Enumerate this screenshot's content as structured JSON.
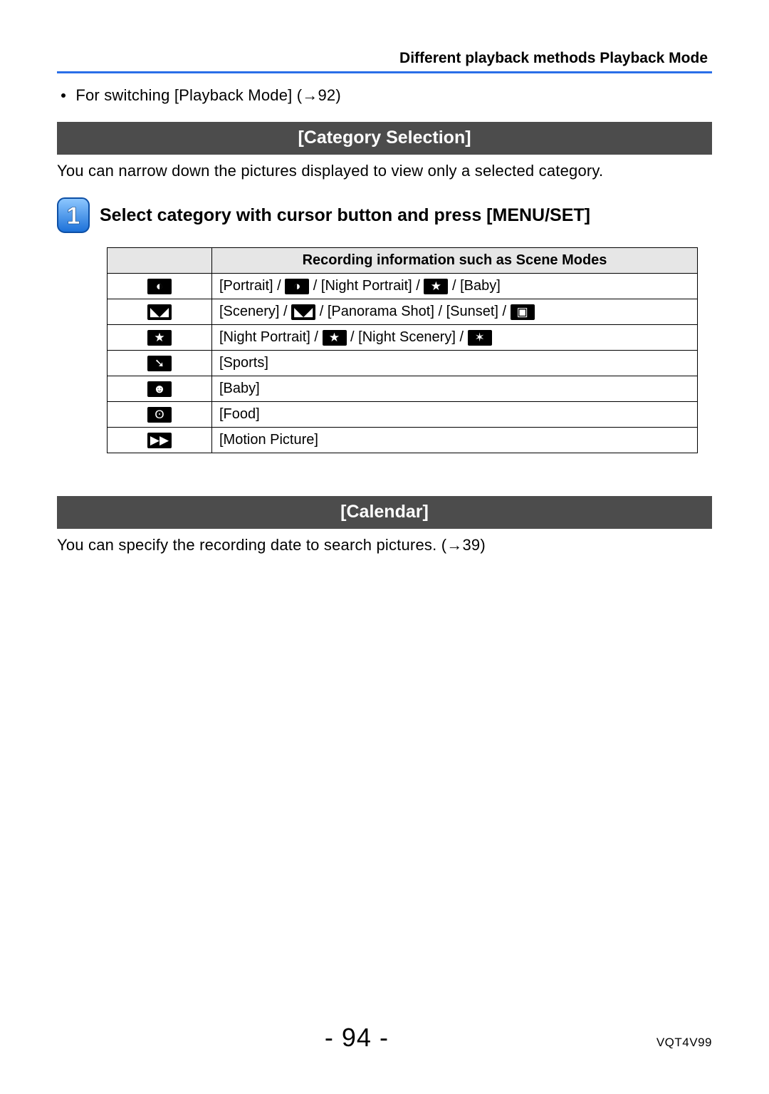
{
  "header": {
    "breadcrumb": "Different playback methods  Playback Mode"
  },
  "intro": {
    "switch_note": "For switching [Playback Mode] (→92)"
  },
  "section1": {
    "title": "[Category Selection]",
    "desc": "You can narrow down the pictures displayed to view only a selected category.",
    "step1_title": "Select category with cursor button and press [MENU/SET]",
    "table_header": "Recording information such as Scene Modes",
    "rows": [
      {
        "icon": "portrait-icon",
        "parts": [
          "[Portrait] / ",
          "icon:soft-portrait-icon",
          " / [Night Portrait] / ",
          "icon:hdr-portrait-icon",
          " / [Baby]"
        ]
      },
      {
        "icon": "scenery-icon",
        "parts": [
          "[Scenery] / ",
          "icon:scenery-alt-icon",
          " / [Panorama Shot] / [Sunset] / ",
          "icon:glass-icon"
        ]
      },
      {
        "icon": "night-portrait-icon",
        "parts": [
          "[Night Portrait] / ",
          "icon:night-portrait-alt-icon",
          " / [Night Scenery] / ",
          "icon:handheld-night-icon"
        ]
      },
      {
        "icon": "sports-icon",
        "parts": [
          "[Sports]"
        ]
      },
      {
        "icon": "baby-icon",
        "parts": [
          "[Baby]"
        ]
      },
      {
        "icon": "food-icon",
        "parts": [
          "[Food]"
        ]
      },
      {
        "icon": "motion-picture-icon",
        "parts": [
          "[Motion Picture]"
        ]
      }
    ],
    "icon_glyphs": {
      "portrait-icon": "◐",
      "scenery-icon": "◣◢",
      "night-portrait-icon": "★",
      "sports-icon": "➘",
      "baby-icon": "☻",
      "food-icon": "ʘ",
      "motion-picture-icon": "▶▶",
      "soft-portrait-icon": "◑",
      "hdr-portrait-icon": "★",
      "scenery-alt-icon": "◣◢",
      "glass-icon": "▣",
      "night-portrait-alt-icon": "★",
      "handheld-night-icon": "✶"
    }
  },
  "section2": {
    "title": "[Calendar]",
    "desc": "You can specify the recording date to search pictures. (→39)"
  },
  "footer": {
    "page": "- 94 -",
    "doc_code": "VQT4V99"
  }
}
